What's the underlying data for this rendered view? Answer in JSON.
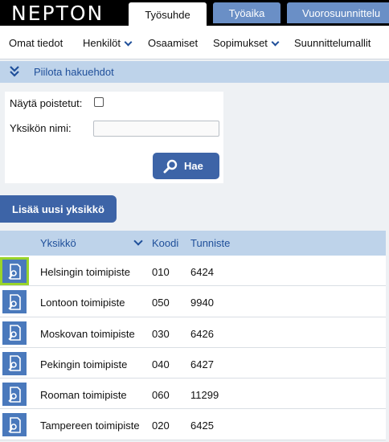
{
  "app": {
    "logo": "NEPTON"
  },
  "tabs": [
    {
      "label": "Työsuhde",
      "active": true
    },
    {
      "label": "Työaika",
      "active": false
    },
    {
      "label": "Vuorosuunnittelu",
      "active": false
    }
  ],
  "subnav": [
    {
      "label": "Omat tiedot",
      "dropdown": false
    },
    {
      "label": "Henkilöt",
      "dropdown": true
    },
    {
      "label": "Osaamiset",
      "dropdown": false
    },
    {
      "label": "Sopimukset",
      "dropdown": true
    },
    {
      "label": "Suunnittelumallit",
      "dropdown": false
    }
  ],
  "filter": {
    "toggle_label": "Piilota hakuehdot"
  },
  "search": {
    "show_deleted_label": "Näytä poistetut:",
    "show_deleted_checked": false,
    "unit_name_label": "Yksikön nimi:",
    "unit_name_value": "",
    "search_button": "Hae"
  },
  "add_unit_button": "Lisää uusi yksikkö",
  "table": {
    "columns": [
      "Yksikkö",
      "Koodi",
      "Tunniste"
    ],
    "sorted_column": "Yksikkö",
    "rows": [
      {
        "name": "Helsingin toimipiste",
        "code": "010",
        "id": "6424",
        "selected": true
      },
      {
        "name": "Lontoon toimipiste",
        "code": "050",
        "id": "9940",
        "selected": false
      },
      {
        "name": "Moskovan toimipiste",
        "code": "030",
        "id": "6426",
        "selected": false
      },
      {
        "name": "Pekingin toimipiste",
        "code": "040",
        "id": "6427",
        "selected": false
      },
      {
        "name": "Rooman toimipiste",
        "code": "060",
        "id": "11299",
        "selected": false
      },
      {
        "name": "Tampereen toimipiste",
        "code": "020",
        "id": "6425",
        "selected": false
      }
    ]
  },
  "colors": {
    "accent": "#3d64a7",
    "header_bg": "#bed3ea",
    "link": "#1f4f9a",
    "selected_outline": "#9ad42a"
  }
}
